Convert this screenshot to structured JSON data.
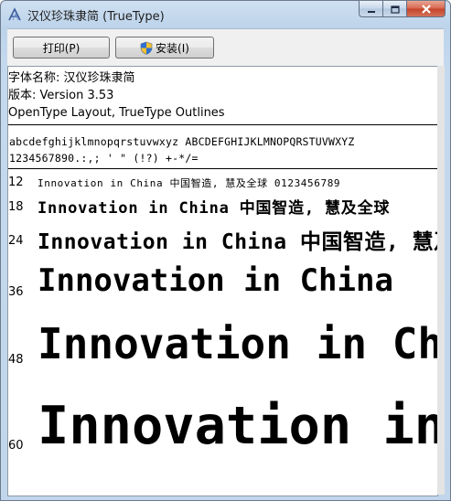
{
  "window": {
    "title": "汉仪珍珠隶简 (TrueType)"
  },
  "toolbar": {
    "print_label": "打印(P)",
    "install_label": "安装(I)"
  },
  "info": {
    "font_name_line": "字体名称: 汉仪珍珠隶简",
    "version_line": "版本: Version 3.53",
    "features_line": "OpenType Layout, TrueType Outlines"
  },
  "charset": {
    "line1": "abcdefghijklmnopqrstuvwxyz ABCDEFGHIJKLMNOPQRSTUVWXYZ",
    "line2": "1234567890.:,; ' \" (!?) +-*/="
  },
  "samples": [
    {
      "size": "12",
      "text": "Innovation in China 中国智造, 慧及全球 0123456789"
    },
    {
      "size": "18",
      "text": "Innovation in China 中国智造, 慧及全球"
    },
    {
      "size": "24",
      "text": "Innovation in China 中国智造, 慧及全"
    },
    {
      "size": "36",
      "text": "Innovation in China"
    },
    {
      "size": "48",
      "text": "Innovation in Chi"
    },
    {
      "size": "60",
      "text": "Innovation in"
    }
  ],
  "icons": {
    "app": "font-viewer-icon",
    "shield": "uac-shield-icon"
  }
}
